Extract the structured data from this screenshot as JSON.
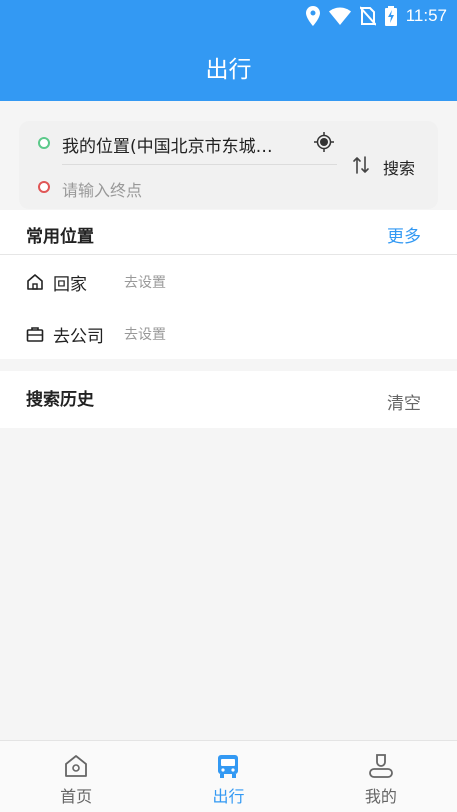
{
  "status_bar": {
    "time": "11:57"
  },
  "header": {
    "title": "出行"
  },
  "route": {
    "origin": "我的位置(中国北京市东城…",
    "destination_placeholder": "请输入终点",
    "search_label": "搜索"
  },
  "common_places": {
    "title": "常用位置",
    "more_label": "更多",
    "items": [
      {
        "label": "回家",
        "value": "去设置",
        "icon": "home-icon"
      },
      {
        "label": "去公司",
        "value": "去设置",
        "icon": "briefcase-icon"
      }
    ]
  },
  "history": {
    "title": "搜索历史",
    "clear_label": "清空"
  },
  "tabbar": {
    "tabs": [
      {
        "label": "首页",
        "icon": "home-tab-icon",
        "active": false
      },
      {
        "label": "出行",
        "icon": "bus-icon",
        "active": true
      },
      {
        "label": "我的",
        "icon": "user-icon",
        "active": false
      }
    ]
  },
  "colors": {
    "primary": "#3399f3",
    "start_dot": "#5cc98a",
    "end_dot": "#e05656"
  }
}
